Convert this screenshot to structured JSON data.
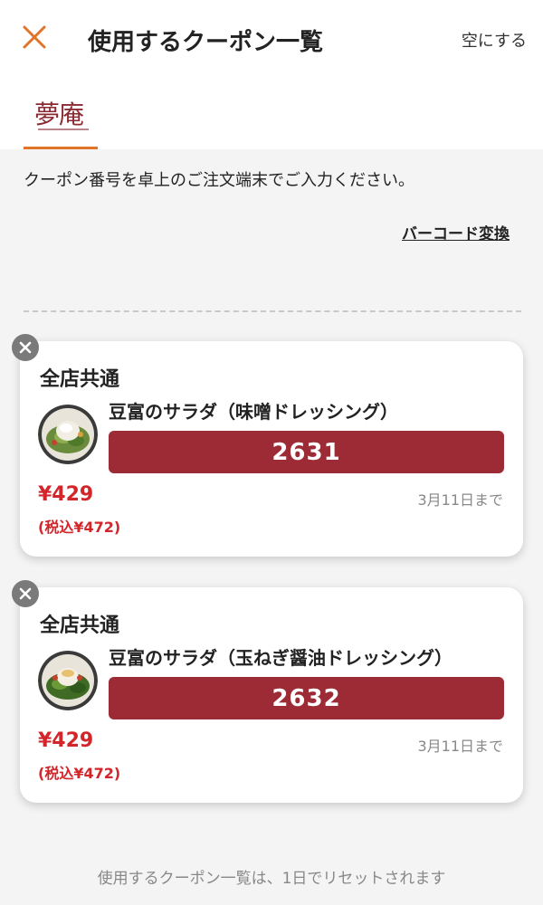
{
  "header": {
    "title": "使用するクーポン一覧",
    "clear_label": "空にする",
    "close_icon": "close-icon",
    "accent_color": "#e2742a"
  },
  "brand": {
    "logo_text": "夢庵",
    "brand_color": "#8c2a32"
  },
  "instruction": "クーポン番号を卓上のご注文端末でご入力ください。",
  "barcode_link": "バーコード変換",
  "coupons": [
    {
      "store": "全店共通",
      "product": "豆富のサラダ（味噌ドレッシング）",
      "code": "2631",
      "price": "¥429",
      "price_tax": "(税込¥472)",
      "expiry": "3月11日まで"
    },
    {
      "store": "全店共通",
      "product": "豆富のサラダ（玉ねぎ醤油ドレッシング）",
      "code": "2632",
      "price": "¥429",
      "price_tax": "(税込¥472)",
      "expiry": "3月11日まで"
    }
  ],
  "footer_note": "使用するクーポン一覧は、1日でリセットされます",
  "colors": {
    "code_bg": "#9c2b35",
    "price": "#d2262b",
    "muted": "#888888"
  }
}
